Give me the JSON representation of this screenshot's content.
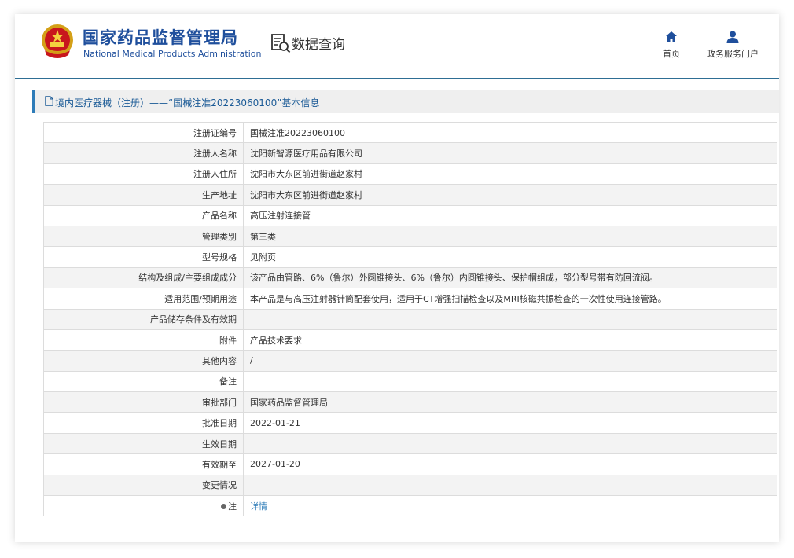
{
  "header": {
    "brand_cn": "国家药品监督管理局",
    "brand_en": "National Medical Products Administration",
    "query_label": "数据查询",
    "nav": [
      {
        "label": "首页",
        "icon": "home-icon"
      },
      {
        "label": "政务服务门户",
        "icon": "user-icon"
      }
    ]
  },
  "title": "境内医疗器械（注册）——“国械注准20223060100”基本信息",
  "rows": [
    {
      "key": "注册证编号",
      "value": "国械注准20223060100"
    },
    {
      "key": "注册人名称",
      "value": "沈阳新智源医疗用品有限公司"
    },
    {
      "key": "注册人住所",
      "value": "沈阳市大东区前进街道赵家村"
    },
    {
      "key": "生产地址",
      "value": "沈阳市大东区前进街道赵家村"
    },
    {
      "key": "产品名称",
      "value": "高压注射连接管"
    },
    {
      "key": "管理类别",
      "value": "第三类"
    },
    {
      "key": "型号规格",
      "value": "见附页"
    },
    {
      "key": "结构及组成/主要组成成分",
      "value": "该产品由管路、6%（鲁尔）外圆锥接头、6%（鲁尔）内圆锥接头、保护帽组成，部分型号带有防回流阀。"
    },
    {
      "key": "适用范围/预期用途",
      "value": "本产品是与高压注射器针筒配套使用，适用于CT增强扫描检查以及MRI核磁共振检查的一次性使用连接管路。"
    },
    {
      "key": "产品储存条件及有效期",
      "value": ""
    },
    {
      "key": "附件",
      "value": "产品技术要求"
    },
    {
      "key": "其他内容",
      "value": "/"
    },
    {
      "key": "备注",
      "value": ""
    },
    {
      "key": "审批部门",
      "value": "国家药品监督管理局"
    },
    {
      "key": "批准日期",
      "value": "2022-01-21"
    },
    {
      "key": "生效日期",
      "value": ""
    },
    {
      "key": "有效期至",
      "value": "2027-01-20"
    },
    {
      "key": "变更情况",
      "value": ""
    }
  ],
  "note": {
    "key": "注",
    "value": "详情"
  },
  "colors": {
    "brand": "#1f4f9c",
    "accent": "#2e7cb8",
    "header_rule": "#2e6e94"
  }
}
